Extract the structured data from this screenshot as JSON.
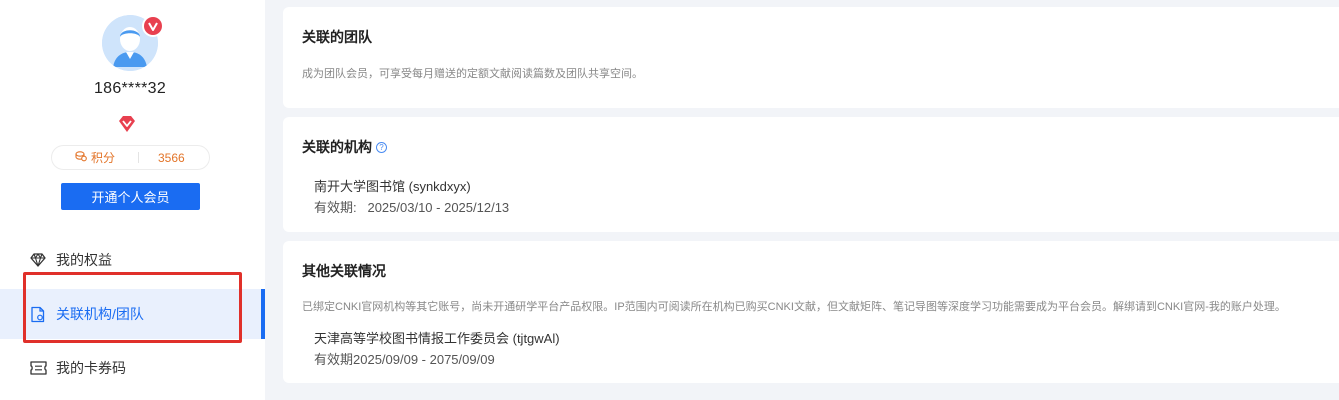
{
  "sidebar": {
    "username": "186****32",
    "points_label": "积分",
    "points_value": "3566",
    "vip_button": "开通个人会员",
    "nav": [
      {
        "label": "我的权益",
        "icon": "diamond-icon"
      },
      {
        "label": "关联机构/团队",
        "icon": "document-icon"
      },
      {
        "label": "我的卡券码",
        "icon": "ticket-icon"
      }
    ]
  },
  "team_card": {
    "title": "关联的团队",
    "desc": "成为团队会员，可享受每月赠送的定额文献阅读篇数及团队共享空间。"
  },
  "org_card": {
    "title": "关联的机构",
    "help_glyph": "?",
    "org_name": "南开大学图书馆 (synkdxyx)",
    "valid_label": "有效期:",
    "valid_range": "2025/03/10 - 2025/12/13"
  },
  "other_card": {
    "title": "其他关联情况",
    "desc": "已绑定CNKI官网机构等其它账号，尚未开通研学平台产品权限。IP范围内可阅读所在机构已购买CNKI文献，但文献矩阵、笔记导图等深度学习功能需要成为平台会员。解绑请到CNKI官网-我的账户处理。",
    "org_name": "天津高等学校图书情报工作委员会 (tjtgwAl)",
    "valid_text": "有效期2025/09/09 - 2075/09/09"
  },
  "colors": {
    "accent": "#1a6cf2",
    "points": "#e3752a",
    "vip_red": "#e8404f",
    "highlight": "#e0302a"
  }
}
